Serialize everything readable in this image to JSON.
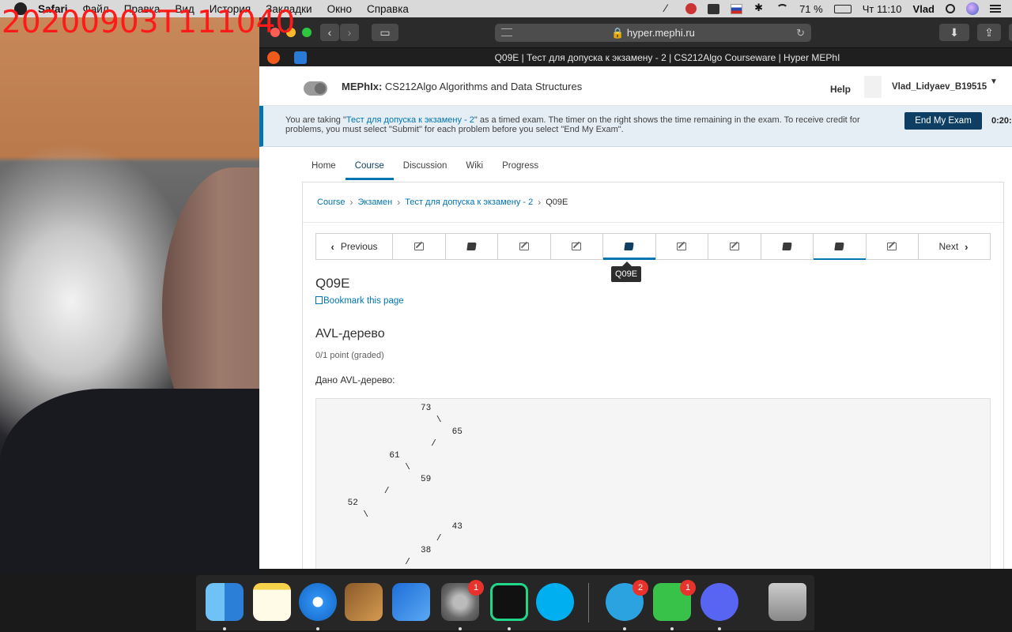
{
  "overlay": {
    "timestamp": "20200903T111040"
  },
  "menubar": {
    "items": [
      "Safari",
      "Файл",
      "Правка",
      "Вид",
      "История",
      "Закладки",
      "Окно",
      "Справка"
    ],
    "battery": "71 %",
    "clock": "Чт 11:10",
    "user": "Vlad"
  },
  "browser": {
    "address": "hyper.mephi.ru",
    "tab_title": "Q09E | Тест для допуска к экзамену - 2 | CS212Algo Courseware | Hyper MEPhI"
  },
  "header": {
    "org": "MEPhIx:",
    "course": "CS212Algo Algorithms and Data Structures",
    "help": "Help",
    "username": "Vlad_Lidyaev_B19515"
  },
  "exam": {
    "text_before": "You are taking \"",
    "exam_link": "Тест для допуска к экзамену - 2",
    "text_after": "\" as a timed exam. The timer on the right shows the time remaining in the exam. To receive credit for problems, you must select \"Submit\" for each problem before you select \"End My Exam\".",
    "end_button": "End My Exam",
    "timer": "0:20:"
  },
  "tabs": [
    "Home",
    "Course",
    "Discussion",
    "Wiki",
    "Progress"
  ],
  "breadcrumb": [
    "Course",
    "Экзамен",
    "Тест для допуска к экзамену - 2",
    "Q09E"
  ],
  "sequence": {
    "previous": "Previous",
    "next": "Next",
    "tooltip": "Q09E",
    "items": [
      "pencil-icon",
      "book-icon",
      "pencil-icon",
      "pencil-icon",
      "book-icon",
      "pencil-icon",
      "pencil-icon",
      "book-icon",
      "book-icon",
      "pencil-icon"
    ]
  },
  "unit": {
    "title": "Q09E",
    "bookmark": "Bookmark this page"
  },
  "problem": {
    "title": "AVL-дерево",
    "points": "0/1 point (graded)",
    "text": "Дано AVL-дерево:",
    "tree_lines": [
      "                    73",
      "                       \\",
      "                          65",
      "                      /",
      "              61",
      "                 \\",
      "                    59",
      "             /",
      "      52",
      "         \\",
      "                          43",
      "                       /",
      "                    38",
      "                 /"
    ]
  },
  "dock": {
    "apps": [
      "finder-icon",
      "notes-icon",
      "safari-icon",
      "garageband-icon",
      "xcode-icon",
      "system-preferences-icon",
      "pycharm-icon",
      "skype-icon",
      "telegram-icon",
      "facetime-icon",
      "discord-icon",
      "trash-icon"
    ],
    "badges": {
      "system-preferences": "1",
      "telegram": "2",
      "facetime": "1"
    }
  }
}
